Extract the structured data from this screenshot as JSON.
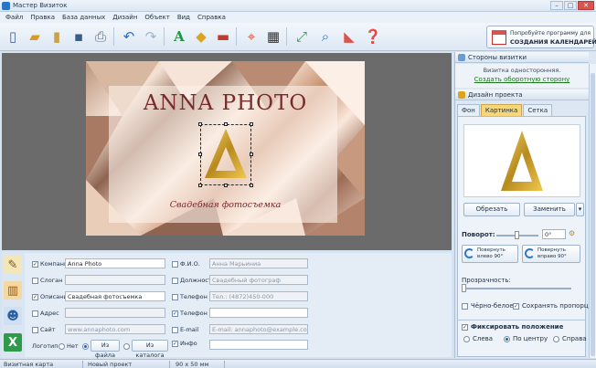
{
  "window": {
    "title": "Мастер Визиток"
  },
  "menu": [
    "Файл",
    "Правка",
    "База данных",
    "Дизайн",
    "Объект",
    "Вид",
    "Справка"
  ],
  "promo": {
    "line1": "Попробуйте программу для",
    "line2": "СОЗДАНИЯ КАЛЕНДАРЕЙ"
  },
  "card": {
    "company": "ANNA PHOTO",
    "slogan": "Свадебная фотосъемка"
  },
  "right_panel": {
    "sides_header": "Стороны визитки",
    "sides_info": "Визитка односторонняя.",
    "sides_link": "Создать оборотную сторону",
    "design_header": "Дизайн проекта",
    "tabs": [
      {
        "label": "Фон",
        "active": false
      },
      {
        "label": "Картинка",
        "active": true
      },
      {
        "label": "Сетка",
        "active": false
      }
    ],
    "crop_label": "Обрезать",
    "replace_label": "Заменить",
    "rotation_label": "Поворот:",
    "rotation_value": "0°",
    "rotate_left": "Повернуть влево 90°",
    "rotate_right": "Повернуть вправо 90°",
    "transparency_label": "Прозрачность:",
    "bw_label": "Чёрно-белое",
    "keep_proportions_label": "Сохранять пропорции",
    "fix_position_label": "Фиксировать положение",
    "positions": [
      {
        "label": "Слева",
        "checked": false
      },
      {
        "label": "По центру",
        "checked": true
      },
      {
        "label": "Справа",
        "checked": false
      }
    ]
  },
  "form": {
    "rows_left": [
      {
        "label": "Компания",
        "checked": true,
        "value": "Anna Photo",
        "dim": false
      },
      {
        "label": "Слоган",
        "checked": false,
        "value": "",
        "dim": true
      },
      {
        "label": "Описание",
        "checked": true,
        "value": "Свадебная фотосъемка",
        "dim": false
      },
      {
        "label": "Адрес",
        "checked": false,
        "value": "",
        "dim": true
      },
      {
        "label": "Сайт",
        "checked": false,
        "value": "www.annaphoto.com",
        "dim": true
      }
    ],
    "rows_right": [
      {
        "label": "Ф.И.О.",
        "checked": false,
        "value": "Анна Марьиниа",
        "dim": true
      },
      {
        "label": "Должность",
        "checked": false,
        "value": "Свадебный фотограф",
        "dim": true
      },
      {
        "label": "Телефон 1",
        "checked": false,
        "value": "Тел.: (4872)450-000",
        "dim": true
      },
      {
        "label": "Телефон 2",
        "checked": true,
        "value": "",
        "dim": false
      },
      {
        "label": "E-mail",
        "checked": false,
        "value": "E-mail: annaphoto@example.com",
        "dim": true
      },
      {
        "label": "Инфо",
        "checked": true,
        "value": "",
        "dim": false
      }
    ],
    "logo_label": "Логотип",
    "logo_options": [
      {
        "label": "Нет",
        "checked": false
      },
      {
        "label": "Из файла",
        "checked": true
      },
      {
        "label": "Из каталога",
        "checked": false
      }
    ]
  },
  "status": {
    "left": "Визитная карта",
    "project": "Новый проект",
    "size": "90 x 50 мм"
  }
}
